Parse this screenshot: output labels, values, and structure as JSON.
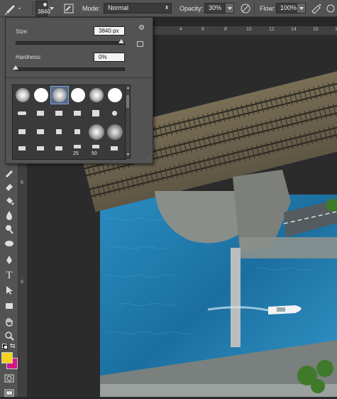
{
  "options_bar": {
    "brush_size": "3840",
    "mode_label": "Mode:",
    "mode_value": "Normal",
    "opacity_label": "Opacity:",
    "opacity_value": "30%",
    "flow_label": "Flow:",
    "flow_value": "100%"
  },
  "brush_panel": {
    "size_label": "Size:",
    "size_value": "3840 px",
    "hardness_label": "Hardness:",
    "hardness_value": "0%",
    "size_slider_fraction": 0.98,
    "hardness_slider_fraction": 0.0,
    "preset_numbers": [
      "25",
      "50"
    ]
  },
  "ruler": {
    "top_marks": [
      "4",
      "6",
      "8",
      "10",
      "12",
      "14",
      "16",
      "18"
    ],
    "left_marks": [
      "6",
      "8"
    ]
  },
  "colors": {
    "foreground": "#f5d21d",
    "background": "#d4148e",
    "panel": "#535353",
    "water": "#1e7fb0"
  }
}
